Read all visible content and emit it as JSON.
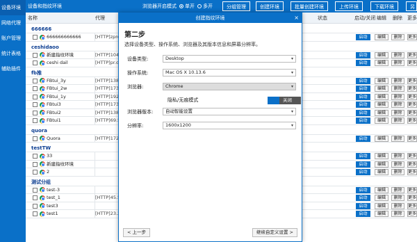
{
  "sidebar": {
    "items": [
      {
        "label": "设备环境"
      },
      {
        "label": "网络代理"
      },
      {
        "label": "账户管理"
      },
      {
        "label": "统计表格"
      },
      {
        "label": "辅助插件"
      }
    ]
  },
  "topbar": {
    "title": "设备和指纹环境",
    "mode_label": "浏览器开启模式",
    "mode_single": "单开",
    "mode_multi": "多开",
    "btn_group": "分组管理",
    "btn_create": "创建环境",
    "btn_batch": "批量创建环境",
    "btn_upload": "上传环境",
    "btn_download": "下载环境",
    "btn_extra": "另"
  },
  "table_header": {
    "name": "名称",
    "proxy": "代理",
    "status": "状态",
    "start": "启动/关闭",
    "edit": "编辑",
    "delete": "删除",
    "more": "更多"
  },
  "row_actions": {
    "start": "启动",
    "edit": "编辑",
    "delete": "删除",
    "more": "更多"
  },
  "groups": [
    {
      "name": "666666",
      "rows": [
        {
          "name": "666666666666",
          "proxy": "[HTTP]zpro"
        }
      ]
    },
    {
      "name": "ceshidaoo",
      "rows": [
        {
          "name": "新建指纹环境",
          "proxy": "[HTTP]104"
        },
        {
          "name": "ceshi dail",
          "proxy": "[HTTP]pr.ox"
        }
      ]
    },
    {
      "name": "fb推",
      "rows": [
        {
          "name": "FBtui_3y",
          "proxy": "[HTTP]138"
        },
        {
          "name": "FBtui_2w",
          "proxy": "[HTTP]173"
        },
        {
          "name": "FBtui_1y",
          "proxy": "[HTTP]192"
        },
        {
          "name": "FBtui3",
          "proxy": "[HTTP]173"
        },
        {
          "name": "FBtui2",
          "proxy": "[HTTP]138"
        },
        {
          "name": "FBtui1",
          "proxy": "[HTTP]69.5"
        }
      ]
    },
    {
      "name": "quora",
      "rows": [
        {
          "name": "Quora",
          "proxy": "[HTTP]172"
        }
      ]
    },
    {
      "name": "testTW",
      "rows": [
        {
          "name": "33",
          "proxy": ""
        },
        {
          "name": "新建指纹环境",
          "proxy": ""
        },
        {
          "name": "2",
          "proxy": ""
        }
      ]
    },
    {
      "name": "测试分组",
      "rows": [
        {
          "name": "test-3",
          "proxy": ""
        },
        {
          "name": "test_1",
          "proxy": "[HTTP]45.5"
        },
        {
          "name": "test3",
          "proxy": ""
        },
        {
          "name": "test1",
          "proxy": "[HTTP]23.2"
        }
      ]
    }
  ],
  "modal": {
    "title": "创建指纹环境",
    "step": "第二步",
    "description": "选择设备类型、操作系统、浏览器及其版本信息和屏幕分辨率。",
    "device_label": "设备类型:",
    "device_value": "Desktop",
    "os_label": "操作系统:",
    "os_value": "Mac OS X 10.13.6",
    "browser_label": "浏览器:",
    "browser_value": "Chrome",
    "privacy_label": "隐私/无痕模式",
    "privacy_toggle": "关闭",
    "version_label": "浏览器版本:",
    "version_value": "自动智能设置",
    "resolution_label": "分辨率:",
    "resolution_value": "1600x1200",
    "prev_button": "< 上一步",
    "next_button": "继续自定义设置 >"
  }
}
